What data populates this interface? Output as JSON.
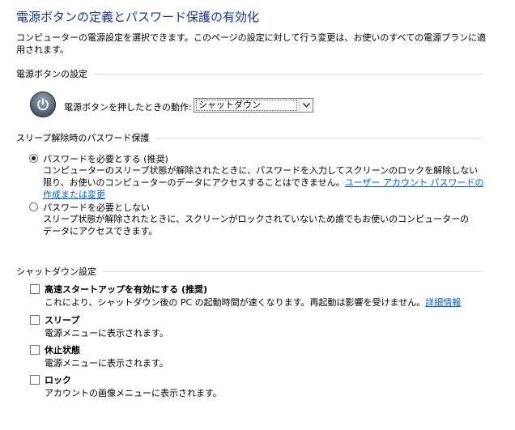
{
  "header": {
    "title": "電源ボタンの定義とパスワード保護の有効化",
    "intro": "コンピューターの電源設定を選択できます。このページの設定に対して行う変更は、お使いのすべての電源プランに適用されます。"
  },
  "power_button": {
    "section_label": "電源ボタンの設定",
    "action_label": "電源ボタンを押したときの動作:",
    "selected_value": "シャットダウン"
  },
  "wake_password": {
    "section_label": "スリープ解除時のパスワード保護",
    "options": [
      {
        "label": "パスワードを必要とする (推奨)",
        "selected": true,
        "desc": "コンピューターのスリープ状態が解除されたときに、パスワードを入力してスクリーンのロックを解除しない限り、お使いのコンピューターのデータにアクセスすることはできません。",
        "link": "ユーザー アカウント パスワードの作成または変更"
      },
      {
        "label": "パスワードを必要としない",
        "selected": false,
        "desc": "スリープ状態が解除されたときに、スクリーンがロックされていないため誰でもお使いのコンピューターのデータにアクセスできます。"
      }
    ]
  },
  "shutdown": {
    "section_label": "シャットダウン設定",
    "options": [
      {
        "label": "高速スタートアップを有効にする (推奨)",
        "checked": false,
        "desc": "これにより、シャットダウン後の PC の起動時間が速くなります。再起動は影響を受けません。",
        "link": "詳細情報"
      },
      {
        "label": "スリープ",
        "checked": false,
        "desc": "電源メニューに表示されます。"
      },
      {
        "label": "休止状態",
        "checked": false,
        "desc": "電源メニューに表示されます。"
      },
      {
        "label": "ロック",
        "checked": false,
        "desc": "アカウントの画像メニューに表示されます。"
      }
    ]
  },
  "icons": {
    "power": "power-icon",
    "dropdown": "chevron-down-icon"
  }
}
